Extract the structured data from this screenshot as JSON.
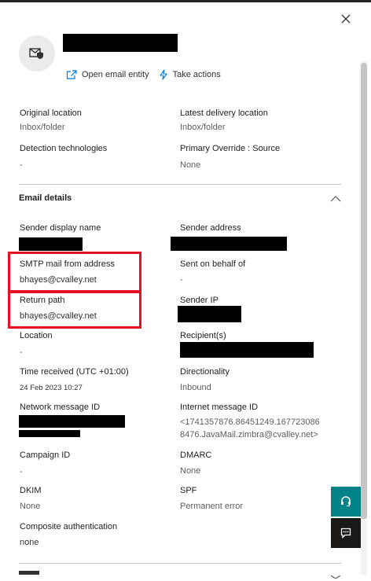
{
  "header": {
    "actions": [
      {
        "label": "Open email entity",
        "icon": "open-external-icon"
      },
      {
        "label": "Take actions",
        "icon": "lightning-icon"
      }
    ]
  },
  "summary": {
    "original_location": {
      "label": "Original location",
      "value": "Inbox/folder"
    },
    "latest_delivery_location": {
      "label": "Latest delivery location",
      "value": "Inbox/folder"
    },
    "detection_technologies": {
      "label": "Detection technologies",
      "value": "-"
    },
    "primary_override": {
      "label": "Primary Override : Source",
      "value": "None"
    }
  },
  "email_details": {
    "title": "Email details",
    "sender_display_name": {
      "label": "Sender display name"
    },
    "sender_address": {
      "label": "Sender address"
    },
    "smtp_mail_from": {
      "label": "SMTP mail from address",
      "value": "bhayes@cvalley.net"
    },
    "sent_on_behalf_of": {
      "label": "Sent on behalf of",
      "value": "-"
    },
    "return_path": {
      "label": "Return path",
      "value": "bhayes@cvalley.net"
    },
    "sender_ip": {
      "label": "Sender IP"
    },
    "location": {
      "label": "Location",
      "value": "-"
    },
    "recipients": {
      "label": "Recipient(s)"
    },
    "time_received": {
      "label": "Time received (UTC +01:00)",
      "value": "24 Feb 2023 10:27"
    },
    "directionality": {
      "label": "Directionality",
      "value": "Inbound"
    },
    "network_message_id": {
      "label": "Network message ID"
    },
    "internet_message_id": {
      "label": "Internet message ID",
      "value_line1": "<1741357876.86451249.167723086",
      "value_line2": "8476.JavaMail.zimbra@cvalley.net>"
    },
    "campaign_id": {
      "label": "Campaign ID",
      "value": "-"
    },
    "dmarc": {
      "label": "DMARC",
      "value": "None"
    },
    "dkim": {
      "label": "DKIM",
      "value": "None"
    },
    "spf": {
      "label": "SPF",
      "value": "Permanent error"
    },
    "composite_auth": {
      "label": "Composite authentication",
      "value": "none"
    }
  },
  "colors": {
    "highlight": "#e81123",
    "side_teal": "#038387",
    "side_dark": "#1b1a19"
  }
}
